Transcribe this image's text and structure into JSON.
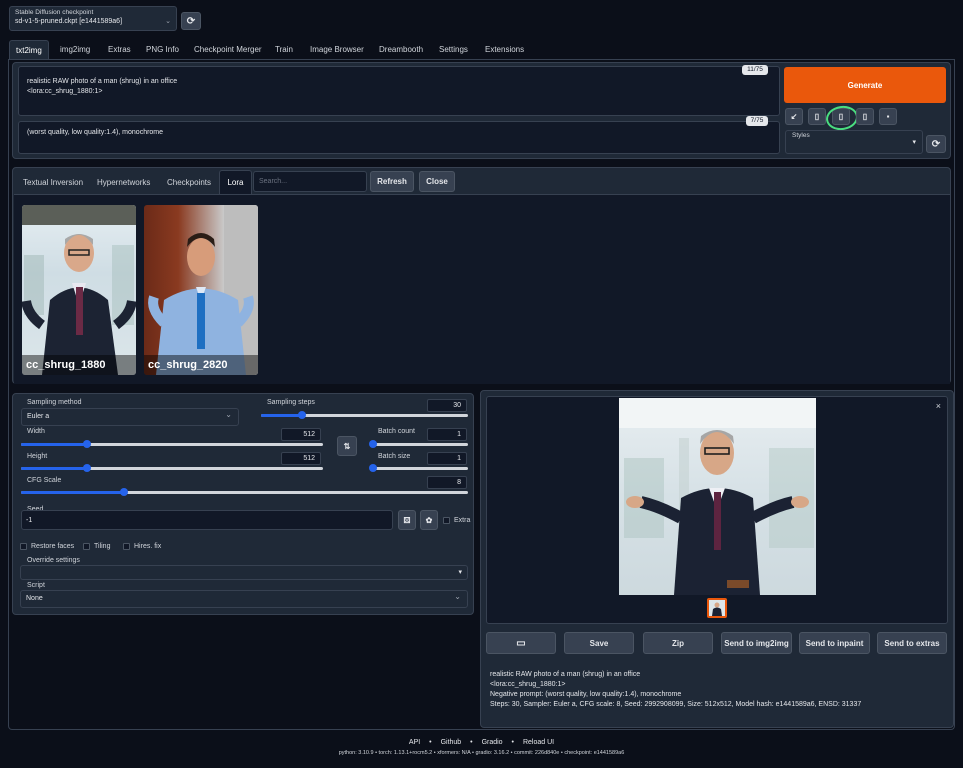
{
  "checkpoint": {
    "label": "Stable Diffusion checkpoint",
    "value": "sd-v1-5-pruned.ckpt [e1441589a6]"
  },
  "tabs": [
    "txt2img",
    "img2img",
    "Extras",
    "PNG Info",
    "Checkpoint Merger",
    "Train",
    "Image Browser",
    "Dreambooth",
    "Settings",
    "Extensions"
  ],
  "prompt": {
    "line1": "realistic RAW photo of a man (shrug) in an office",
    "line2": "<lora:cc_shrug_1880:1>",
    "counter": "11/75"
  },
  "negative": {
    "text": "(worst quality, low quality:1.4), monochrome",
    "counter": "7/75"
  },
  "generate_label": "Generate",
  "styles_label": "Styles",
  "extra_tabs": [
    "Textual Inversion",
    "Hypernetworks",
    "Checkpoints",
    "Lora"
  ],
  "search_placeholder": "Search...",
  "refresh_label": "Refresh",
  "close_label": "Close",
  "cards": [
    {
      "name": "cc_shrug_1880"
    },
    {
      "name": "cc_shrug_2820"
    }
  ],
  "settings": {
    "sampling_method_label": "Sampling method",
    "sampling_method": "Euler a",
    "sampling_steps_label": "Sampling steps",
    "sampling_steps": "30",
    "width_label": "Width",
    "width": "512",
    "height_label": "Height",
    "height": "512",
    "batch_count_label": "Batch count",
    "batch_count": "1",
    "batch_size_label": "Batch size",
    "batch_size": "1",
    "cfg_label": "CFG Scale",
    "cfg": "8",
    "seed_label": "Seed",
    "seed": "-1",
    "extra_label": "Extra",
    "restore_faces": "Restore faces",
    "tiling": "Tiling",
    "hires": "Hires. fix",
    "override_label": "Override settings",
    "script_label": "Script",
    "script_value": "None"
  },
  "slider_levels": {
    "sampling_steps": 0.2,
    "width": 0.22,
    "height": 0.22,
    "batch_count": 0.0,
    "batch_size": 0.0,
    "cfg": 0.23
  },
  "output_buttons": [
    "Save",
    "Zip",
    "Send to img2img",
    "Send to inpaint",
    "Send to extras"
  ],
  "info": {
    "line1": "realistic RAW photo of a man (shrug) in an office",
    "line2": "<lora:cc_shrug_1880:1>",
    "line3": "Negative prompt: (worst quality, low quality:1.4), monochrome",
    "line4": "Steps: 30, Sampler: Euler a, CFG scale: 8, Seed: 2992908099, Size: 512x512, Model hash: e1441589a6, ENSD: 31337"
  },
  "footer": {
    "links": [
      "API",
      "Github",
      "Gradio",
      "Reload UI"
    ],
    "versions": "python: 3.10.9  •  torch: 1.13.1+rocm5.2  •  xformers: N/A  •  gradio: 3.16.2  •  commit: 226d840e  •  checkpoint: e1441589a6"
  },
  "colors": {
    "accent": "#ea580c",
    "slider": "#2563eb",
    "highlight_circle": "#4ade80"
  }
}
